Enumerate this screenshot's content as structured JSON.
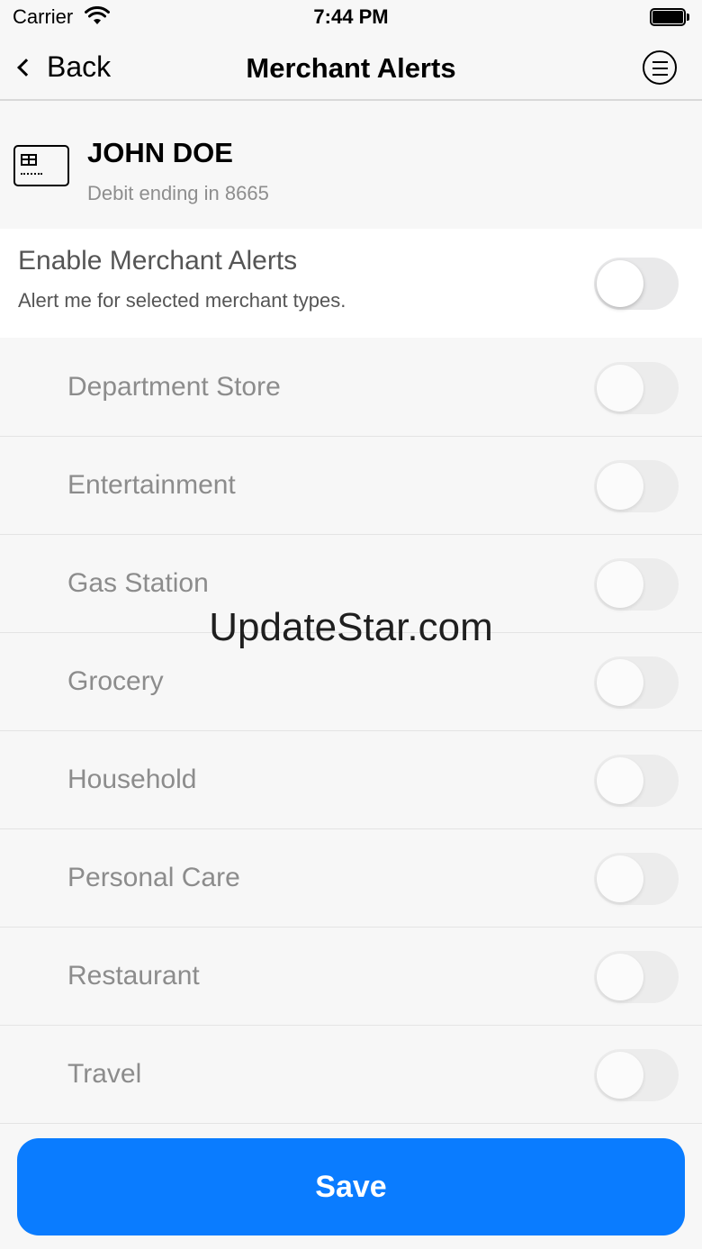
{
  "status_bar": {
    "carrier": "Carrier",
    "time": "7:44 PM"
  },
  "nav": {
    "back_label": "Back",
    "title": "Merchant Alerts"
  },
  "account": {
    "name": "JOHN DOE",
    "subtitle": "Debit ending in 8665"
  },
  "master_toggle": {
    "title": "Enable Merchant Alerts",
    "subtitle": "Alert me for selected merchant types.",
    "enabled": false
  },
  "categories": [
    {
      "label": "Department Store",
      "enabled": false
    },
    {
      "label": "Entertainment",
      "enabled": false
    },
    {
      "label": "Gas Station",
      "enabled": false
    },
    {
      "label": "Grocery",
      "enabled": false
    },
    {
      "label": "Household",
      "enabled": false
    },
    {
      "label": "Personal Care",
      "enabled": false
    },
    {
      "label": "Restaurant",
      "enabled": false
    },
    {
      "label": "Travel",
      "enabled": false
    }
  ],
  "watermark": "UpdateStar.com",
  "save_label": "Save",
  "colors": {
    "accent": "#0a7cff",
    "background": "#f7f7f7",
    "toggle_off": "#e9e9ea"
  }
}
